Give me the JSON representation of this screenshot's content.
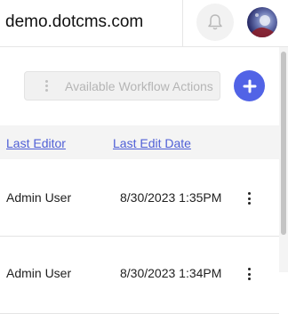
{
  "header": {
    "domain": "demo.dotcms.com",
    "notifications_icon": "bell-icon",
    "avatar_icon": "user-avatar"
  },
  "toolbar": {
    "workflow_actions_label": "Available Workflow Actions",
    "add_icon": "plus-icon"
  },
  "table": {
    "columns": [
      "Last Editor",
      "Last Edit Date"
    ],
    "rows": [
      {
        "editor": "Admin User",
        "date": "8/30/2023 1:35PM"
      },
      {
        "editor": "Admin User",
        "date": "8/30/2023 1:34PM"
      }
    ]
  },
  "colors": {
    "accent": "#5163e6",
    "link": "#4f5fd6"
  }
}
